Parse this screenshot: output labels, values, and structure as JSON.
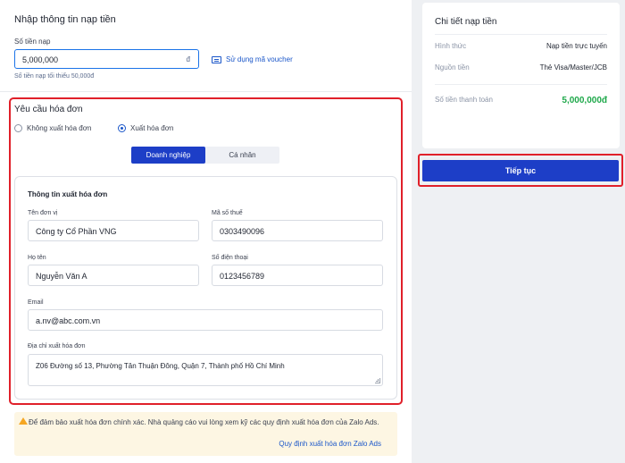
{
  "topup": {
    "title": "Nhập thông tin nạp tiền",
    "amount_label": "Số tiền nạp",
    "amount_value": "5,000,000",
    "currency_symbol": "đ",
    "voucher_link": "Sử dụng mã voucher",
    "min_hint": "Số tiền nạp tối thiểu 50,000đ"
  },
  "invoice": {
    "title": "Yêu cầu hóa đơn",
    "option_no": "Không xuất hóa đơn",
    "option_yes": "Xuất hóa đơn",
    "selected_option": "Xuất hóa đơn",
    "tabs": [
      "Doanh nghiệp",
      "Cá nhân"
    ],
    "active_tab": "Doanh nghiệp",
    "info_title": "Thông tin xuất hóa đơn",
    "company_label": "Tên đơn vị",
    "company_value": "Công ty Cổ Phần VNG",
    "tax_label": "Mã số thuế",
    "tax_value": "0303490096",
    "name_label": "Họ tên",
    "name_value": "Nguyễn Văn A",
    "phone_label": "Số điện thoại",
    "phone_value": "0123456789",
    "email_label": "Email",
    "email_value": "a.nv@abc.com.vn",
    "address_label": "Địa chỉ xuất hóa đơn",
    "address_value": "Z06 Đường số 13, Phường Tân Thuận Đông, Quận 7, Thành phố Hồ Chí Minh"
  },
  "notice": {
    "text": "Để đảm bảo xuất hóa đơn chính xác. Nhà quảng cáo vui lòng xem kỹ các quy định xuất hóa đơn của Zalo Ads.",
    "link": "Quy định xuất hóa đơn Zalo Ads"
  },
  "summary": {
    "title": "Chi tiết nạp tiền",
    "rows": [
      {
        "label": "Hình thức",
        "value": "Nạp tiền trực tuyến"
      },
      {
        "label": "Nguồn tiền",
        "value": "Thẻ Visa/Master/JCB"
      }
    ],
    "total_label": "Số tiền thanh toán",
    "total_value": "5,000,000đ",
    "continue_label": "Tiếp tục"
  },
  "colors": {
    "primary": "#1d3ec7",
    "highlight": "#e0202a",
    "total": "#1ea84a",
    "notice_bg": "#fdf6e3"
  },
  "icons": [
    "voucher-icon",
    "warning-icon",
    "resize-handle-icon"
  ]
}
